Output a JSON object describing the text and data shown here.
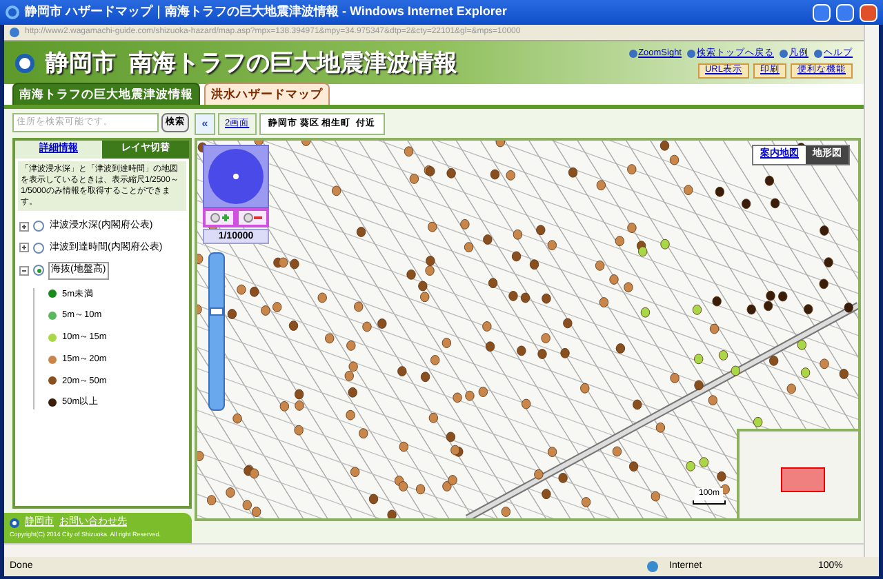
{
  "window": {
    "title": "静岡市 ハザードマップ｜南海トラフの巨大地震津波情報 - Windows Internet Explorer"
  },
  "address": {
    "url": "http://www2.wagamachi-guide.com/shizuoka-hazard/map.asp?mpx=138.394971&mpy=34.975347&dtp=2&cty=22101&gl=&mps=10000"
  },
  "banner": {
    "title": "静岡市  南海トラフの巨大地震津波情報",
    "links": [
      "ZoomSight",
      "検索トップへ戻る",
      "凡例",
      "ヘルプ"
    ],
    "buttons": [
      "URL表示",
      "印刷",
      "便利な機能"
    ]
  },
  "tabs": [
    {
      "label": "南海トラフの巨大地震津波情報",
      "selected": true
    },
    {
      "label": "洪水ハザードマップ",
      "selected": false
    }
  ],
  "search": {
    "placeholder": "住所を検索可能です。",
    "button": "検索"
  },
  "panel_tabs": [
    {
      "label": "詳細情報",
      "selected": false
    },
    {
      "label": "レイヤ切替",
      "selected": true
    }
  ],
  "note": "「津波浸水深」と「津波到達時間」の地図を表示しているときは、表示縮尺1/2500～1/5000のみ情報を取得することができます。",
  "layers": [
    {
      "label": "津波浸水深(内閣府公表)",
      "selected": false,
      "expanded": false
    },
    {
      "label": "津波到達時間(内閣府公表)",
      "selected": false,
      "expanded": false
    },
    {
      "label": "海抜(地盤高)",
      "selected": true,
      "expanded": true,
      "children": [
        {
          "label": "5m未満",
          "color": "#1a8a1a"
        },
        {
          "label": "5m～10m",
          "color": "#5cb85c"
        },
        {
          "label": "10m～15m",
          "color": "#a8d848"
        },
        {
          "label": "15m～20m",
          "color": "#c8864a"
        },
        {
          "label": "20m～50m",
          "color": "#8a4f1e"
        },
        {
          "label": "50m以上",
          "color": "#3a1e0a"
        }
      ]
    }
  ],
  "footer": {
    "links": [
      "静岡市",
      "お問い合わせ先"
    ],
    "copyright": "Copyright(C) 2014 City of Shizuoka. All right Reserved."
  },
  "map_bar": {
    "collapse": "«",
    "split": "2画面",
    "location": "静岡市 葵区 相生町  付近"
  },
  "map": {
    "zoom_slider": {
      "level": 0.64
    },
    "scale": "1/10000",
    "scale_bar": "100m",
    "map_types": [
      {
        "label": "案内地図",
        "selected": false
      },
      {
        "label": "地形図",
        "selected": true
      }
    ]
  },
  "status_bar": {
    "status": "Done",
    "zone": "Internet",
    "zoom": "100%"
  }
}
